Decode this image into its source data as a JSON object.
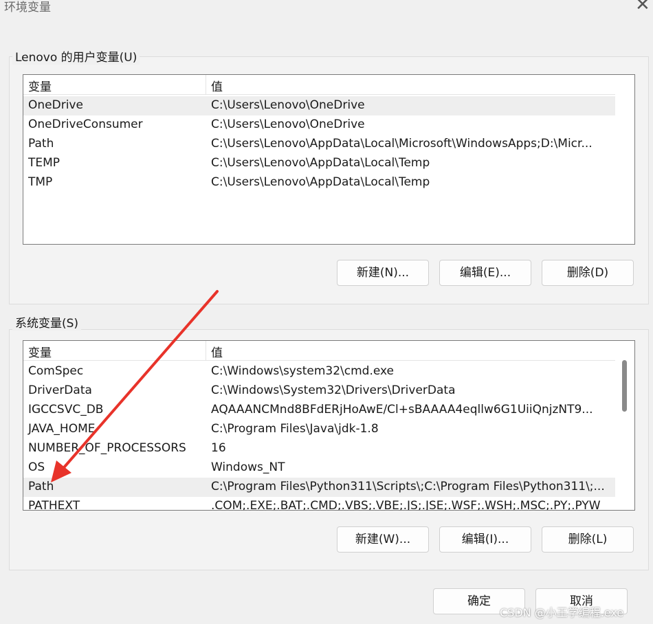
{
  "window": {
    "title": "环境变量"
  },
  "user_vars": {
    "label": "Lenovo 的用户变量(U)",
    "headers": {
      "name": "变量",
      "value": "值"
    },
    "rows": [
      {
        "name": "OneDrive",
        "value": "C:\\Users\\Lenovo\\OneDrive"
      },
      {
        "name": "OneDriveConsumer",
        "value": "C:\\Users\\Lenovo\\OneDrive"
      },
      {
        "name": "Path",
        "value": "C:\\Users\\Lenovo\\AppData\\Local\\Microsoft\\WindowsApps;D:\\Micr..."
      },
      {
        "name": "TEMP",
        "value": "C:\\Users\\Lenovo\\AppData\\Local\\Temp"
      },
      {
        "name": "TMP",
        "value": "C:\\Users\\Lenovo\\AppData\\Local\\Temp"
      }
    ],
    "buttons": {
      "new": "新建(N)...",
      "edit": "编辑(E)...",
      "delete": "删除(D)"
    }
  },
  "system_vars": {
    "label": "系统变量(S)",
    "headers": {
      "name": "变量",
      "value": "值"
    },
    "rows": [
      {
        "name": "ComSpec",
        "value": "C:\\Windows\\system32\\cmd.exe"
      },
      {
        "name": "DriverData",
        "value": "C:\\Windows\\System32\\Drivers\\DriverData"
      },
      {
        "name": "IGCCSVC_DB",
        "value": "AQAAANCMnd8BFdERjHoAwE/Cl+sBAAAA4eqllw6G1UiiQnjzNT9..."
      },
      {
        "name": "JAVA_HOME",
        "value": "C:\\Program Files\\Java\\jdk-1.8"
      },
      {
        "name": "NUMBER_OF_PROCESSORS",
        "value": "16"
      },
      {
        "name": "OS",
        "value": "Windows_NT"
      },
      {
        "name": "Path",
        "value": "C:\\Program Files\\Python311\\Scripts\\;C:\\Program Files\\Python311\\;..."
      },
      {
        "name": "PATHEXT",
        "value": ".COM;.EXE;.BAT;.CMD;.VBS;.VBE;.JS;.JSE;.WSF;.WSH;.MSC;.PY;.PYW"
      }
    ],
    "buttons": {
      "new": "新建(W)...",
      "edit": "编辑(I)...",
      "delete": "删除(L)"
    }
  },
  "footer": {
    "ok": "确定",
    "cancel": "取消"
  },
  "watermark": "CSDN @小王学编程.exe",
  "icons": {
    "close": "close-icon",
    "annotation": "red-arrow-annotation"
  },
  "colors": {
    "annotation": "#e8332a",
    "selection": "#eeeeee"
  }
}
